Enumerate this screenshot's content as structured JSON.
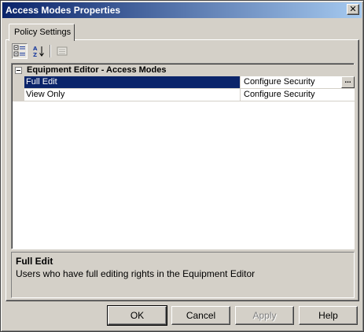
{
  "window": {
    "title": "Access Modes Properties",
    "close_glyph": "✕"
  },
  "tabs": [
    {
      "label": "Policy Settings"
    }
  ],
  "toolbar": {
    "buttons": [
      {
        "icon": "categorized-icon",
        "pressed": true
      },
      {
        "icon": "alphabetical-sort-icon",
        "pressed": false
      },
      {
        "icon": "property-pages-icon",
        "pressed": false,
        "disabled": true
      }
    ]
  },
  "grid": {
    "category": "Equipment Editor - Access Modes",
    "properties": [
      {
        "name": "Full Edit",
        "value": "Configure Security",
        "selected": true,
        "button": "..."
      },
      {
        "name": "View Only",
        "value": "Configure Security",
        "selected": false
      }
    ]
  },
  "description": {
    "title": "Full Edit",
    "text": "Users who have full editing rights in the Equipment Editor"
  },
  "buttons": {
    "ok": "OK",
    "cancel": "Cancel",
    "apply": "Apply",
    "help": "Help"
  },
  "colors": {
    "title_bar_start": "#0a246a",
    "title_bar_end": "#a6caf0",
    "selection": "#0a246a",
    "face": "#d4d0c8"
  }
}
